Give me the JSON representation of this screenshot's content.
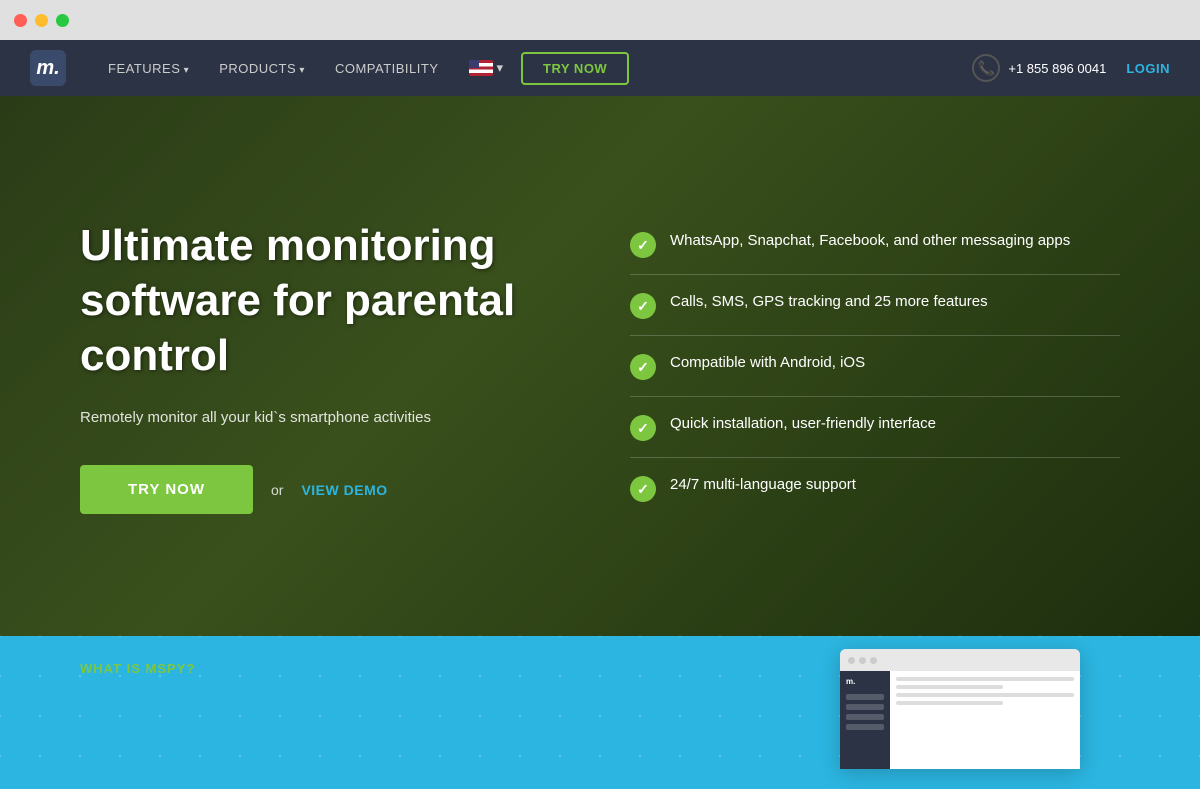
{
  "mac": {
    "dots": [
      "red",
      "yellow",
      "green"
    ]
  },
  "navbar": {
    "logo_text": "m.",
    "nav_items": [
      {
        "label": "FEATURES",
        "has_arrow": true
      },
      {
        "label": "PRODUCTS",
        "has_arrow": true
      },
      {
        "label": "COMPATIBILITY",
        "has_arrow": false
      }
    ],
    "try_now_label": "TRY NOW",
    "phone_number": "+1 855 896 0041",
    "login_label": "LOGIN"
  },
  "hero": {
    "title": "Ultimate monitoring software for parental control",
    "subtitle": "Remotely monitor all your kid`s smartphone activities",
    "try_btn_label": "TRY NOW",
    "or_label": "or",
    "demo_label": "VIEW DEMO",
    "features": [
      {
        "text": "WhatsApp, Snapchat, Facebook, and other messaging apps"
      },
      {
        "text": "Calls, SMS, GPS tracking and 25 more features"
      },
      {
        "text": "Compatible with Android, iOS"
      },
      {
        "text": "Quick installation, user-friendly interface"
      },
      {
        "text": "24/7 multi-language support"
      }
    ]
  },
  "bottom": {
    "what_is_label": "WHAT IS MSPY?"
  },
  "colors": {
    "green": "#7dc740",
    "blue": "#2bb5e0",
    "dark_nav": "#2c3345",
    "white": "#ffffff"
  }
}
